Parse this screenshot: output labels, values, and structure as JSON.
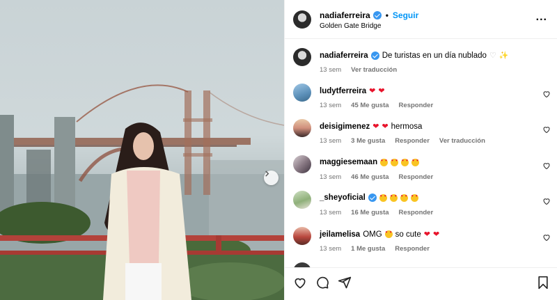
{
  "post": {
    "username": "nadiaferreira",
    "follow_label": "Seguir",
    "location": "Golden Gate Bridge",
    "more_label": "..."
  },
  "caption": {
    "username": "nadiaferreira",
    "text": "De turistas en un día nublado",
    "time": "13 sem",
    "translate": "Ver traducción"
  },
  "comments": [
    {
      "username": "ludytferreira",
      "text": "",
      "time": "13 sem",
      "likes": "45 Me gusta",
      "reply": "Responder",
      "translate": ""
    },
    {
      "username": "deisigimenez",
      "text": "hermosa",
      "time": "13 sem",
      "likes": "3 Me gusta",
      "reply": "Responder",
      "translate": "Ver traducción"
    },
    {
      "username": "maggiesemaan",
      "text": "",
      "time": "13 sem",
      "likes": "46 Me gusta",
      "reply": "Responder",
      "translate": ""
    },
    {
      "username": "_sheyoficial",
      "text": "",
      "time": "13 sem",
      "likes": "16 Me gusta",
      "reply": "Responder",
      "translate": ""
    },
    {
      "username": "jeilamelisa",
      "text_a": "OMG",
      "text_b": "so cute",
      "time": "13 sem",
      "likes": "1 Me gusta",
      "reply": "Responder",
      "translate": ""
    }
  ],
  "icons": [
    "verified-icon",
    "more-icon",
    "heart-icon",
    "comment-icon",
    "share-icon",
    "bookmark-icon",
    "chevron-right-icon"
  ],
  "colors": {
    "accent": "#0095f6",
    "verified": "#3897f0",
    "heart": "#e8142c",
    "meta": "#737373"
  }
}
